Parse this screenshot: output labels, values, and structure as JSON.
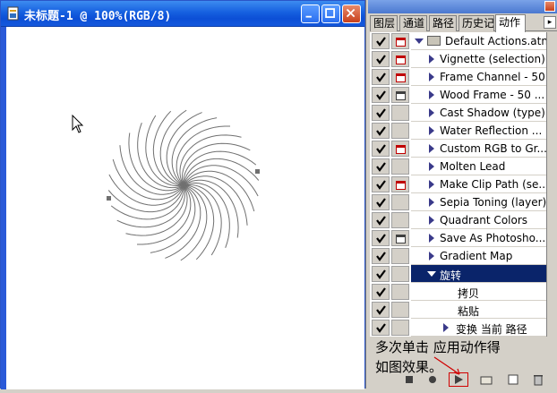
{
  "document": {
    "title": "未标题-1 @ 100%(RGB/8)"
  },
  "panel": {
    "tabs": [
      {
        "label": "图层"
      },
      {
        "label": "通道"
      },
      {
        "label": "路径"
      },
      {
        "label": "历史记"
      },
      {
        "label": "动作"
      }
    ],
    "actions": [
      {
        "label": "Default Actions.atn",
        "checked": true,
        "dialog": "red",
        "kind": "set"
      },
      {
        "label": "Vignette (selection)",
        "checked": true,
        "dialog": "red",
        "kind": "action"
      },
      {
        "label": "Frame Channel - 50...",
        "checked": true,
        "dialog": "red",
        "kind": "action"
      },
      {
        "label": "Wood Frame - 50 ...",
        "checked": true,
        "dialog": "gray",
        "kind": "action"
      },
      {
        "label": "Cast Shadow (type)",
        "checked": true,
        "dialog": "none",
        "kind": "action"
      },
      {
        "label": "Water Reflection ...",
        "checked": true,
        "dialog": "none",
        "kind": "action"
      },
      {
        "label": "Custom RGB to Gr...",
        "checked": true,
        "dialog": "red",
        "kind": "action"
      },
      {
        "label": "Molten Lead",
        "checked": true,
        "dialog": "none",
        "kind": "action"
      },
      {
        "label": "Make Clip Path (se...",
        "checked": true,
        "dialog": "red",
        "kind": "action"
      },
      {
        "label": "Sepia Toning (layer)",
        "checked": true,
        "dialog": "none",
        "kind": "action"
      },
      {
        "label": "Quadrant Colors",
        "checked": true,
        "dialog": "none",
        "kind": "action"
      },
      {
        "label": "Save As Photosho...",
        "checked": true,
        "dialog": "gray",
        "kind": "action"
      },
      {
        "label": "Gradient Map",
        "checked": true,
        "dialog": "none",
        "kind": "action"
      },
      {
        "label": "旋转",
        "checked": true,
        "dialog": "none",
        "kind": "action-open",
        "selected": true
      },
      {
        "label": "拷贝",
        "checked": true,
        "dialog": "none",
        "kind": "step"
      },
      {
        "label": "粘贴",
        "checked": true,
        "dialog": "none",
        "kind": "step"
      },
      {
        "label": "变换 当前 路径",
        "checked": true,
        "dialog": "none",
        "kind": "step-expand"
      }
    ],
    "note_line1": "多次单击  应用动作得",
    "note_line2": "如图效果。"
  },
  "colors": {
    "selection": "#0a246a",
    "title_bar": "#0c4fd6",
    "highlight_red": "#d00000"
  }
}
